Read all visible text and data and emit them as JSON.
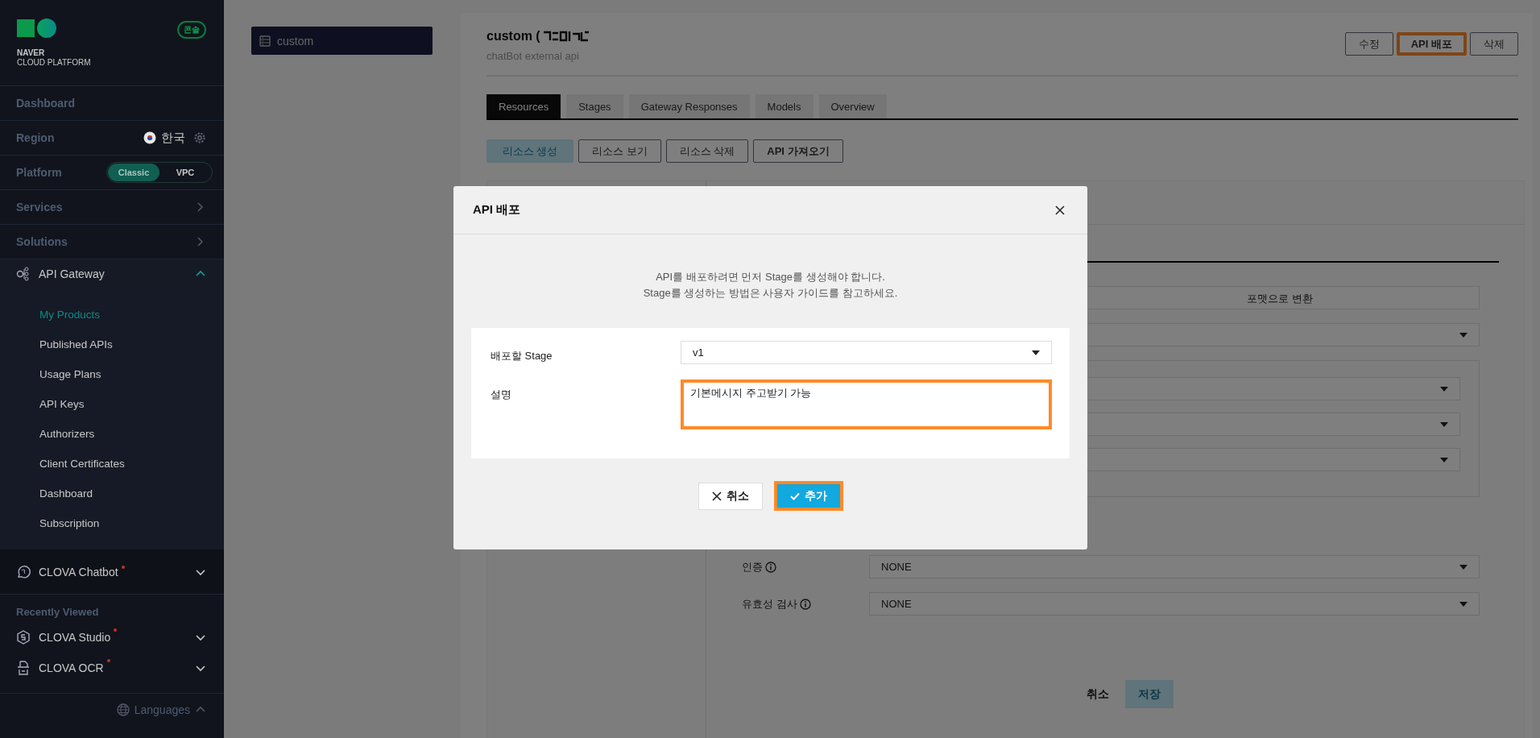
{
  "sidebar": {
    "logo": {
      "line1": "NAVER",
      "line2": "CLOUD PLATFORM"
    },
    "console_badge": "콘솔",
    "items": [
      {
        "kind": "link",
        "label": "Dashboard"
      },
      {
        "kind": "region",
        "label": "Region",
        "value": "한국"
      },
      {
        "kind": "platform",
        "label": "Platform",
        "options": [
          {
            "label": "Classic",
            "selected": true
          },
          {
            "label": "VPC",
            "selected": false
          }
        ]
      },
      {
        "kind": "nav",
        "label": "Services"
      },
      {
        "kind": "nav",
        "label": "Solutions"
      },
      {
        "kind": "product",
        "label": "API Gateway",
        "expanded": true,
        "new": false,
        "children": [
          {
            "label": "My Products",
            "selected": true
          },
          {
            "label": "Published APIs",
            "selected": false
          },
          {
            "label": "Usage Plans",
            "selected": false
          },
          {
            "label": "API Keys",
            "selected": false
          },
          {
            "label": "Authorizers",
            "selected": false
          },
          {
            "label": "Client Certificates",
            "selected": false
          },
          {
            "label": "Dashboard",
            "selected": false
          },
          {
            "label": "Subscription",
            "selected": false
          }
        ]
      },
      {
        "kind": "product",
        "label": "CLOVA Chatbot",
        "expanded": false,
        "new": true
      }
    ],
    "recently_viewed": {
      "title": "Recently Viewed",
      "items": [
        {
          "label": "CLOVA Studio",
          "new": true,
          "expanded": false
        },
        {
          "label": "CLOVA OCR",
          "new": true,
          "expanded": false
        }
      ]
    },
    "languages": "Languages"
  },
  "product_list": [
    {
      "label": "custom",
      "selected": true
    }
  ],
  "api": {
    "title": "custom (",
    "subtitle": "chatBot external api",
    "actions": [
      {
        "label": "수정",
        "highlighted": false
      },
      {
        "label": "API 배포",
        "highlighted": true
      },
      {
        "label": "삭제",
        "highlighted": false
      }
    ]
  },
  "tabs": [
    {
      "label": "Resources",
      "selected": true
    },
    {
      "label": "Stages",
      "selected": false
    },
    {
      "label": "Gateway Responses",
      "selected": false
    },
    {
      "label": "Models",
      "selected": false
    },
    {
      "label": "Overview",
      "selected": false
    }
  ],
  "resource_actions": [
    {
      "label": "리소스 생성",
      "disabled": true
    },
    {
      "label": "리소스 보기",
      "disabled": false
    },
    {
      "label": "리소스 삭제",
      "disabled": false
    },
    {
      "label": "API 가져오기",
      "disabled": false
    }
  ],
  "method_form": {
    "fields": [
      {
        "kind": "text",
        "value": "포맷으로 변환"
      },
      {
        "kind": "select"
      },
      {
        "kind": "group",
        "children": [
          {
            "kind": "select"
          },
          {
            "kind": "select"
          },
          {
            "kind": "select"
          }
        ]
      },
      {
        "kind": "select",
        "label": "인증",
        "info": true,
        "value": "NONE"
      },
      {
        "kind": "select",
        "label": "유효성 검사",
        "info": true,
        "value": "NONE"
      }
    ],
    "buttons": [
      {
        "kind": "text",
        "label": "취소"
      },
      {
        "kind": "primary",
        "label": "저장",
        "disabled": true
      }
    ]
  },
  "modal": {
    "title": "API 배포",
    "message": [
      "API를 배포하려면 먼저 Stage를 생성해야 합니다.",
      "Stage를 생성하는 방법은 사용자 가이드를 참고하세요."
    ],
    "fields": [
      {
        "kind": "select",
        "label": "배포할 Stage",
        "value": "v1",
        "highlighted": false
      },
      {
        "kind": "textarea",
        "label": "설명",
        "value": "기본메시지 주고받기 가능",
        "highlighted": true
      }
    ],
    "buttons": [
      {
        "kind": "cancel",
        "label": "취소",
        "highlighted": false
      },
      {
        "kind": "confirm",
        "label": "추가",
        "highlighted": true
      }
    ]
  }
}
